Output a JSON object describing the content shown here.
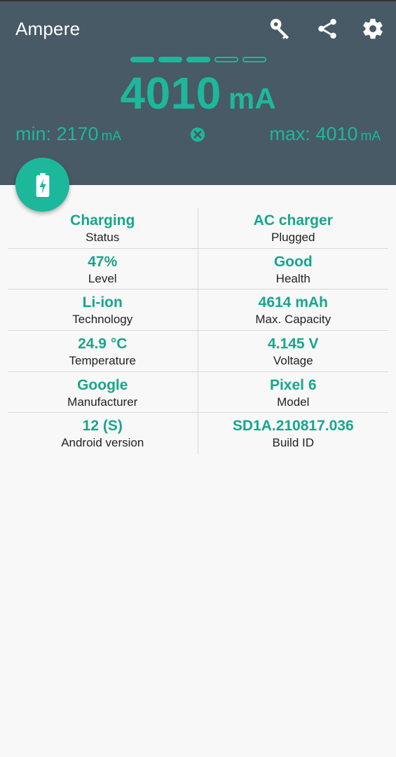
{
  "app": {
    "title": "Ampere"
  },
  "toolbar": {
    "icons": [
      "key-icon",
      "share-icon",
      "gear-icon"
    ]
  },
  "level_indicator": {
    "filled": 3,
    "total": 5
  },
  "current": {
    "value": "4010",
    "unit": "mA"
  },
  "min": {
    "label": "min: 2170",
    "unit": "mA"
  },
  "max": {
    "label": "max: 4010",
    "unit": "mA"
  },
  "fab": {
    "icon": "battery-charging-icon"
  },
  "info": {
    "rows": [
      {
        "left": {
          "value": "Charging",
          "label": "Status"
        },
        "right": {
          "value": "AC charger",
          "label": "Plugged"
        }
      },
      {
        "left": {
          "value": "47%",
          "label": "Level"
        },
        "right": {
          "value": "Good",
          "label": "Health"
        }
      },
      {
        "left": {
          "value": "Li-ion",
          "label": "Technology"
        },
        "right": {
          "value": "4614 mAh",
          "label": "Max. Capacity"
        }
      },
      {
        "left": {
          "value": "24.9 °C",
          "label": "Temperature"
        },
        "right": {
          "value": "4.145 V",
          "label": "Voltage"
        }
      },
      {
        "left": {
          "value": "Google",
          "label": "Manufacturer"
        },
        "right": {
          "value": "Pixel 6",
          "label": "Model"
        }
      },
      {
        "left": {
          "value": "12 (S)",
          "label": "Android version"
        },
        "right": {
          "value": "SD1A.210817.036",
          "label": "Build ID"
        }
      }
    ]
  },
  "colors": {
    "header_bg": "#475a66",
    "accent": "#1db89c",
    "value_text": "#17a68c",
    "body_bg": "#f8f8f8"
  }
}
